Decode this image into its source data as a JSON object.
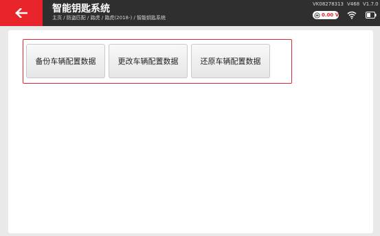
{
  "header": {
    "title": "智能钥匙系统",
    "breadcrumb": "主页 / 防盗匹配 / 路虎 / 路虎(2018-) / 智能钥匙系统",
    "serial_number": "VK08278313",
    "device_version": "V468",
    "app_version": "V1.7.0",
    "voltage": "0.00 V"
  },
  "actions": {
    "backup_label": "备份车辆配置数据",
    "change_label": "更改车辆配置数据",
    "restore_label": "还原车辆配置数据"
  },
  "icons": {
    "back": "arrow-left-icon",
    "voltage": "battery-voltage-icon",
    "wifi": "wifi-icon",
    "battery": "battery-icon"
  },
  "colors": {
    "accent": "#e8242a",
    "topbar": "#2f2f2f",
    "background": "#e9e9e9"
  }
}
